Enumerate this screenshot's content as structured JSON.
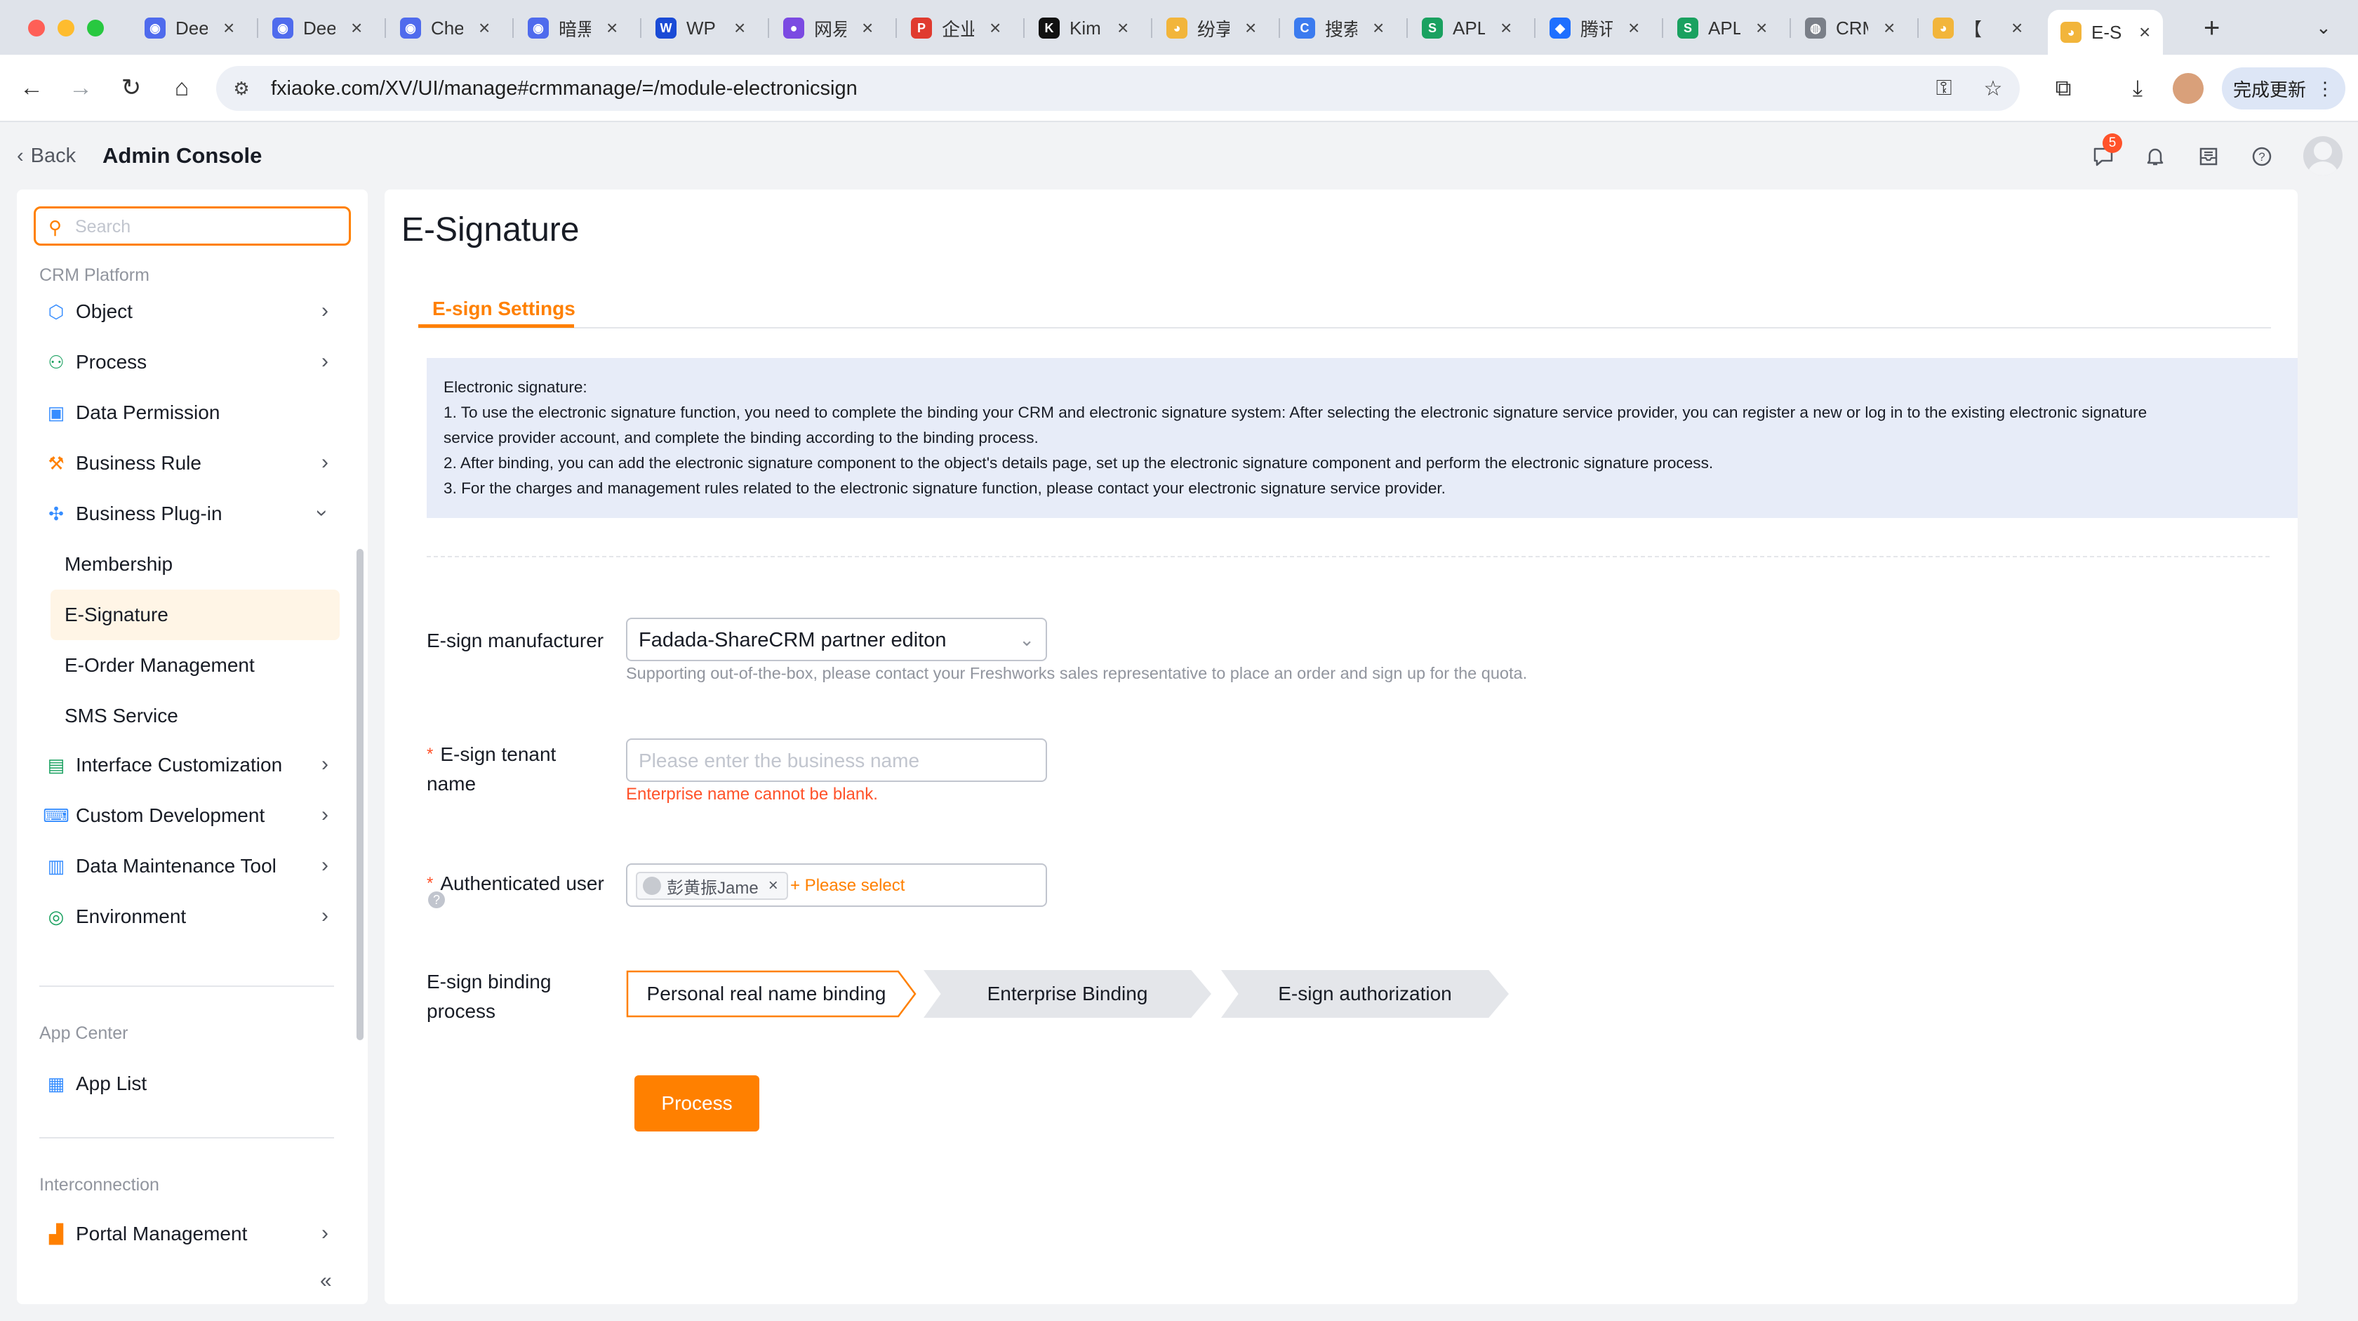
{
  "browser": {
    "tabs": [
      {
        "title": "Dee",
        "fav_color": "#4f6bed",
        "fav_glyph": "◉"
      },
      {
        "title": "Dee",
        "fav_color": "#4f6bed",
        "fav_glyph": "◉"
      },
      {
        "title": "Che",
        "fav_color": "#4f6bed",
        "fav_glyph": "◉"
      },
      {
        "title": "暗黑",
        "fav_color": "#4f6bed",
        "fav_glyph": "◉"
      },
      {
        "title": "WP",
        "fav_color": "#1a4bd6",
        "fav_glyph": "W"
      },
      {
        "title": "网易",
        "fav_color": "#7b4ae2",
        "fav_glyph": "●"
      },
      {
        "title": "企业",
        "fav_color": "#e03b2f",
        "fav_glyph": "P"
      },
      {
        "title": "Kim",
        "fav_color": "#111111",
        "fav_glyph": "K"
      },
      {
        "title": "纷享",
        "fav_color": "#f2b53b",
        "fav_glyph": "◕"
      },
      {
        "title": "搜索",
        "fav_color": "#3b7bef",
        "fav_glyph": "C"
      },
      {
        "title": "APL",
        "fav_color": "#1aa160",
        "fav_glyph": "S"
      },
      {
        "title": "腾讯",
        "fav_color": "#1e6fff",
        "fav_glyph": "◆"
      },
      {
        "title": "APL",
        "fav_color": "#1aa160",
        "fav_glyph": "S"
      },
      {
        "title": "CRM",
        "fav_color": "#7a7f88",
        "fav_glyph": "◍"
      },
      {
        "title": "【",
        "fav_color": "#f2b53b",
        "fav_glyph": "◕"
      },
      {
        "title": "E-S",
        "fav_color": "#f2b53b",
        "fav_glyph": "◕"
      }
    ],
    "url": "fxiaoke.com/XV/UI/manage#crmmanage/=/module-electronicsign",
    "update_label": "完成更新"
  },
  "header": {
    "back_label": "Back",
    "title": "Admin Console",
    "notification_count": "5"
  },
  "sidebar": {
    "search_placeholder": "Search",
    "groups": {
      "crm": "CRM Platform",
      "app_center": "App Center",
      "interconnection": "Interconnection"
    },
    "items": {
      "object": "Object",
      "process": "Process",
      "data_permission": "Data Permission",
      "business_rule": "Business Rule",
      "business_plugin": "Business Plug-in",
      "membership": "Membership",
      "esignature": "E-Signature",
      "eorder": "E-Order Management",
      "sms": "SMS Service",
      "interface": "Interface Customization",
      "custom_dev": "Custom Development",
      "data_maintenance": "Data Maintenance Tool",
      "environment": "Environment",
      "app_list": "App List",
      "portal": "Portal Management"
    }
  },
  "main": {
    "title": "E-Signature",
    "tab": "E-sign Settings",
    "info": {
      "heading": "Electronic signature:",
      "line1": "1. To use the electronic signature function, you need to complete the binding your CRM and electronic signature system: After selecting the electronic signature service provider, you can register a new or log in to the existing electronic signature",
      "line1b": "service provider account, and complete the binding according to the binding process.",
      "line2": "2. After binding, you can add the electronic signature component to the object's details page, set up the electronic signature component and perform the electronic signature process.",
      "line3": "3. For the charges and management rules related to the electronic signature function, please contact your electronic signature service provider."
    },
    "form": {
      "manufacturer_label": "E-sign manufacturer",
      "manufacturer_value": "Fadada-ShareCRM partner editon",
      "manufacturer_hint": "Supporting out-of-the-box, please contact your Freshworks sales representative to place an order and sign up for the quota.",
      "tenant_label_1": "E-sign tenant",
      "tenant_label_2": "name",
      "tenant_placeholder": "Please enter the business name",
      "tenant_error": "Enterprise name cannot be blank.",
      "auth_user_label": "Authenticated user",
      "auth_user_chip": "彭黄振Jame",
      "auth_user_add": "+ Please select",
      "binding_label_1": "E-sign binding",
      "binding_label_2": "process",
      "steps": [
        "Personal real name binding",
        "Enterprise Binding",
        "E-sign authorization"
      ],
      "process_button": "Process"
    }
  }
}
